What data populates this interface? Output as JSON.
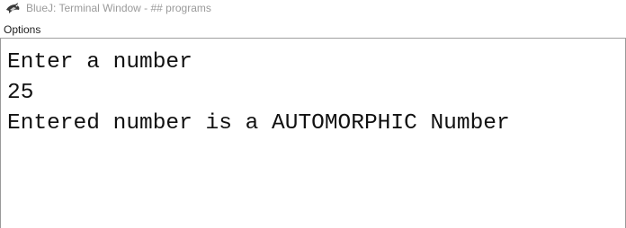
{
  "window": {
    "title": "BlueJ: Terminal Window - ## programs",
    "app_icon": "bluej-bird-icon"
  },
  "menu": {
    "items": [
      {
        "label": "Options"
      }
    ]
  },
  "terminal": {
    "lines": [
      "Enter a number",
      "25",
      "Entered number is a AUTOMORPHIC Number"
    ]
  }
}
